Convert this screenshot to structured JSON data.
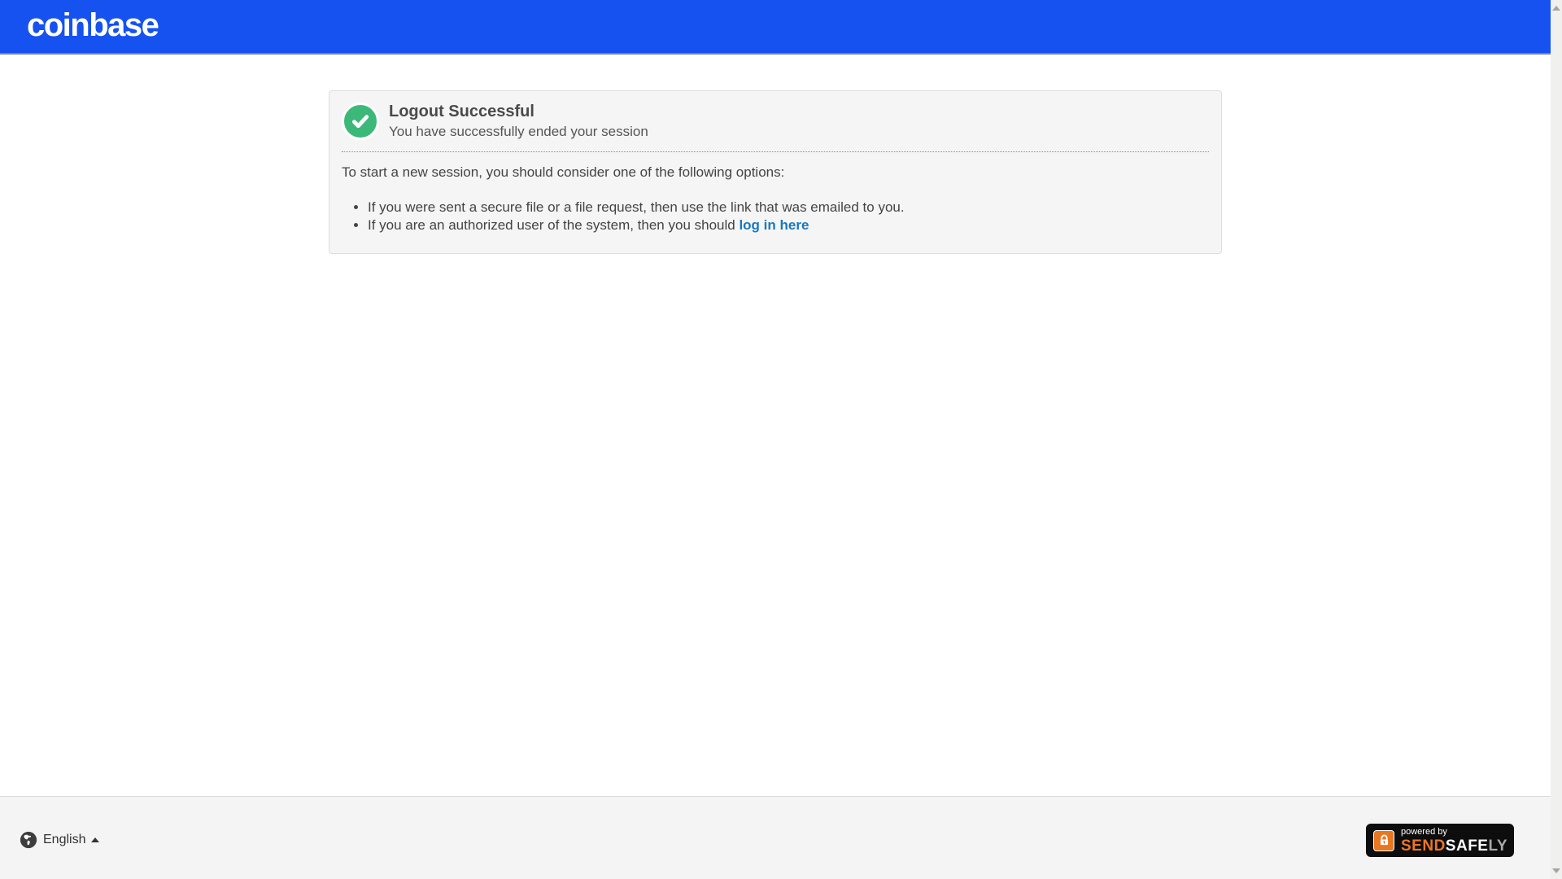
{
  "header": {
    "logo": "coinbase"
  },
  "panel": {
    "title": "Logout Successful",
    "subtitle": "You have successfully ended your session",
    "intro": "To start a new session, you should consider one of the following options:",
    "bullets": [
      {
        "text": "If you were sent a secure file or a file request, then use the link that was emailed to you."
      },
      {
        "text": "If you are an authorized user of the system, then you should ",
        "link_text": "log in here"
      }
    ]
  },
  "footer": {
    "language": "English",
    "badge": {
      "powered_by": "powered by",
      "send": "SEND",
      "safe": "SAFE",
      "ly": "LY"
    }
  },
  "colors": {
    "header_blue": "#1652f0",
    "success_green": "#3cb878",
    "link_blue": "#1878c2",
    "badge_orange": "#e87722"
  }
}
